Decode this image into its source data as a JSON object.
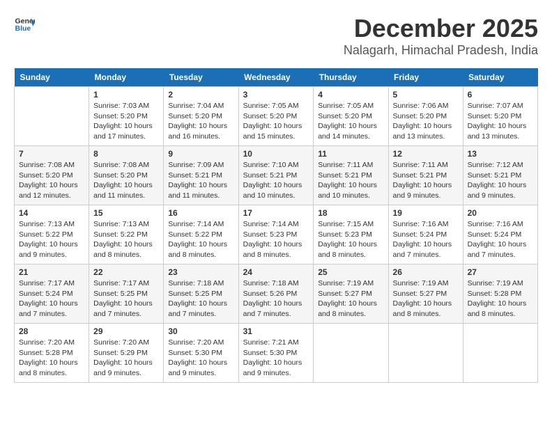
{
  "header": {
    "logo_line1": "General",
    "logo_line2": "Blue",
    "month": "December 2025",
    "location": "Nalagarh, Himachal Pradesh, India"
  },
  "weekdays": [
    "Sunday",
    "Monday",
    "Tuesday",
    "Wednesday",
    "Thursday",
    "Friday",
    "Saturday"
  ],
  "weeks": [
    [
      {
        "day": "",
        "info": ""
      },
      {
        "day": "1",
        "info": "Sunrise: 7:03 AM\nSunset: 5:20 PM\nDaylight: 10 hours\nand 17 minutes."
      },
      {
        "day": "2",
        "info": "Sunrise: 7:04 AM\nSunset: 5:20 PM\nDaylight: 10 hours\nand 16 minutes."
      },
      {
        "day": "3",
        "info": "Sunrise: 7:05 AM\nSunset: 5:20 PM\nDaylight: 10 hours\nand 15 minutes."
      },
      {
        "day": "4",
        "info": "Sunrise: 7:05 AM\nSunset: 5:20 PM\nDaylight: 10 hours\nand 14 minutes."
      },
      {
        "day": "5",
        "info": "Sunrise: 7:06 AM\nSunset: 5:20 PM\nDaylight: 10 hours\nand 13 minutes."
      },
      {
        "day": "6",
        "info": "Sunrise: 7:07 AM\nSunset: 5:20 PM\nDaylight: 10 hours\nand 13 minutes."
      }
    ],
    [
      {
        "day": "7",
        "info": "Sunrise: 7:08 AM\nSunset: 5:20 PM\nDaylight: 10 hours\nand 12 minutes."
      },
      {
        "day": "8",
        "info": "Sunrise: 7:08 AM\nSunset: 5:20 PM\nDaylight: 10 hours\nand 11 minutes."
      },
      {
        "day": "9",
        "info": "Sunrise: 7:09 AM\nSunset: 5:21 PM\nDaylight: 10 hours\nand 11 minutes."
      },
      {
        "day": "10",
        "info": "Sunrise: 7:10 AM\nSunset: 5:21 PM\nDaylight: 10 hours\nand 10 minutes."
      },
      {
        "day": "11",
        "info": "Sunrise: 7:11 AM\nSunset: 5:21 PM\nDaylight: 10 hours\nand 10 minutes."
      },
      {
        "day": "12",
        "info": "Sunrise: 7:11 AM\nSunset: 5:21 PM\nDaylight: 10 hours\nand 9 minutes."
      },
      {
        "day": "13",
        "info": "Sunrise: 7:12 AM\nSunset: 5:21 PM\nDaylight: 10 hours\nand 9 minutes."
      }
    ],
    [
      {
        "day": "14",
        "info": "Sunrise: 7:13 AM\nSunset: 5:22 PM\nDaylight: 10 hours\nand 9 minutes."
      },
      {
        "day": "15",
        "info": "Sunrise: 7:13 AM\nSunset: 5:22 PM\nDaylight: 10 hours\nand 8 minutes."
      },
      {
        "day": "16",
        "info": "Sunrise: 7:14 AM\nSunset: 5:22 PM\nDaylight: 10 hours\nand 8 minutes."
      },
      {
        "day": "17",
        "info": "Sunrise: 7:14 AM\nSunset: 5:23 PM\nDaylight: 10 hours\nand 8 minutes."
      },
      {
        "day": "18",
        "info": "Sunrise: 7:15 AM\nSunset: 5:23 PM\nDaylight: 10 hours\nand 8 minutes."
      },
      {
        "day": "19",
        "info": "Sunrise: 7:16 AM\nSunset: 5:24 PM\nDaylight: 10 hours\nand 7 minutes."
      },
      {
        "day": "20",
        "info": "Sunrise: 7:16 AM\nSunset: 5:24 PM\nDaylight: 10 hours\nand 7 minutes."
      }
    ],
    [
      {
        "day": "21",
        "info": "Sunrise: 7:17 AM\nSunset: 5:24 PM\nDaylight: 10 hours\nand 7 minutes."
      },
      {
        "day": "22",
        "info": "Sunrise: 7:17 AM\nSunset: 5:25 PM\nDaylight: 10 hours\nand 7 minutes."
      },
      {
        "day": "23",
        "info": "Sunrise: 7:18 AM\nSunset: 5:25 PM\nDaylight: 10 hours\nand 7 minutes."
      },
      {
        "day": "24",
        "info": "Sunrise: 7:18 AM\nSunset: 5:26 PM\nDaylight: 10 hours\nand 7 minutes."
      },
      {
        "day": "25",
        "info": "Sunrise: 7:19 AM\nSunset: 5:27 PM\nDaylight: 10 hours\nand 8 minutes."
      },
      {
        "day": "26",
        "info": "Sunrise: 7:19 AM\nSunset: 5:27 PM\nDaylight: 10 hours\nand 8 minutes."
      },
      {
        "day": "27",
        "info": "Sunrise: 7:19 AM\nSunset: 5:28 PM\nDaylight: 10 hours\nand 8 minutes."
      }
    ],
    [
      {
        "day": "28",
        "info": "Sunrise: 7:20 AM\nSunset: 5:28 PM\nDaylight: 10 hours\nand 8 minutes."
      },
      {
        "day": "29",
        "info": "Sunrise: 7:20 AM\nSunset: 5:29 PM\nDaylight: 10 hours\nand 9 minutes."
      },
      {
        "day": "30",
        "info": "Sunrise: 7:20 AM\nSunset: 5:30 PM\nDaylight: 10 hours\nand 9 minutes."
      },
      {
        "day": "31",
        "info": "Sunrise: 7:21 AM\nSunset: 5:30 PM\nDaylight: 10 hours\nand 9 minutes."
      },
      {
        "day": "",
        "info": ""
      },
      {
        "day": "",
        "info": ""
      },
      {
        "day": "",
        "info": ""
      }
    ]
  ]
}
